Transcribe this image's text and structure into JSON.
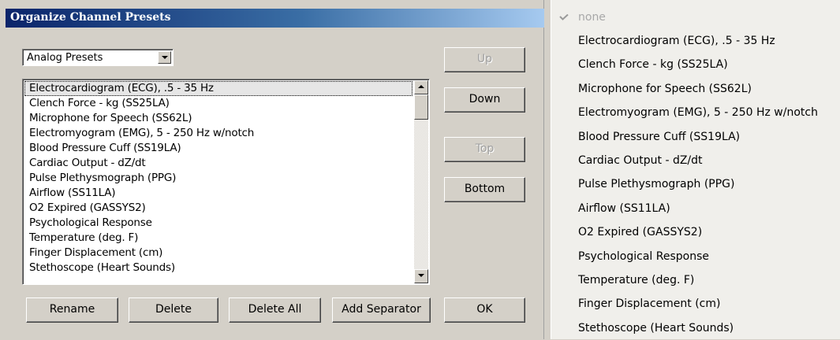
{
  "dialog": {
    "title": "Organize Channel Presets",
    "preset_type": "Analog Presets",
    "list_items": [
      "Electrocardiogram (ECG), .5 - 35 Hz",
      "Clench Force - kg (SS25LA)",
      "Microphone for Speech (SS62L)",
      "Electromyogram (EMG), 5 - 250 Hz w/notch",
      "Blood Pressure Cuff (SS19LA)",
      "Cardiac Output - dZ/dt",
      "Pulse Plethysmograph (PPG)",
      "Airflow (SS11LA)",
      "O2 Expired (GASSYS2)",
      "Psychological Response",
      "Temperature (deg. F)",
      "Finger Displacement (cm)",
      "Stethoscope (Heart Sounds)"
    ],
    "buttons": {
      "up": "Up",
      "down": "Down",
      "top": "Top",
      "bottom": "Bottom",
      "rename": "Rename",
      "delete": "Delete",
      "delete_all": "Delete All",
      "add_separator": "Add Separator",
      "ok": "OK"
    }
  },
  "menu": {
    "none_label": "none",
    "items": [
      "Electrocardiogram (ECG), .5 - 35 Hz",
      "Clench Force - kg (SS25LA)",
      "Microphone for Speech (SS62L)",
      "Electromyogram (EMG), 5 - 250 Hz w/notch",
      "Blood Pressure Cuff (SS19LA)",
      "Cardiac Output - dZ/dt",
      "Pulse Plethysmograph (PPG)",
      "Airflow (SS11LA)",
      "O2 Expired (GASSYS2)",
      "Psychological Response",
      "Temperature (deg. F)",
      "Finger Displacement (cm)",
      "Stethoscope (Heart Sounds)"
    ]
  },
  "icons": {
    "checkmark": "check-icon",
    "dropdown": "chevron-down-icon",
    "scroll_up": "arrow-up-icon",
    "scroll_down": "arrow-down-icon"
  },
  "colors": {
    "titlebar_start": "#0a246a",
    "titlebar_end": "#a6caf0",
    "dialog_bg": "#d4d0c8",
    "menu_bg": "#f0efeb",
    "disabled_text": "#a0a0a0"
  }
}
